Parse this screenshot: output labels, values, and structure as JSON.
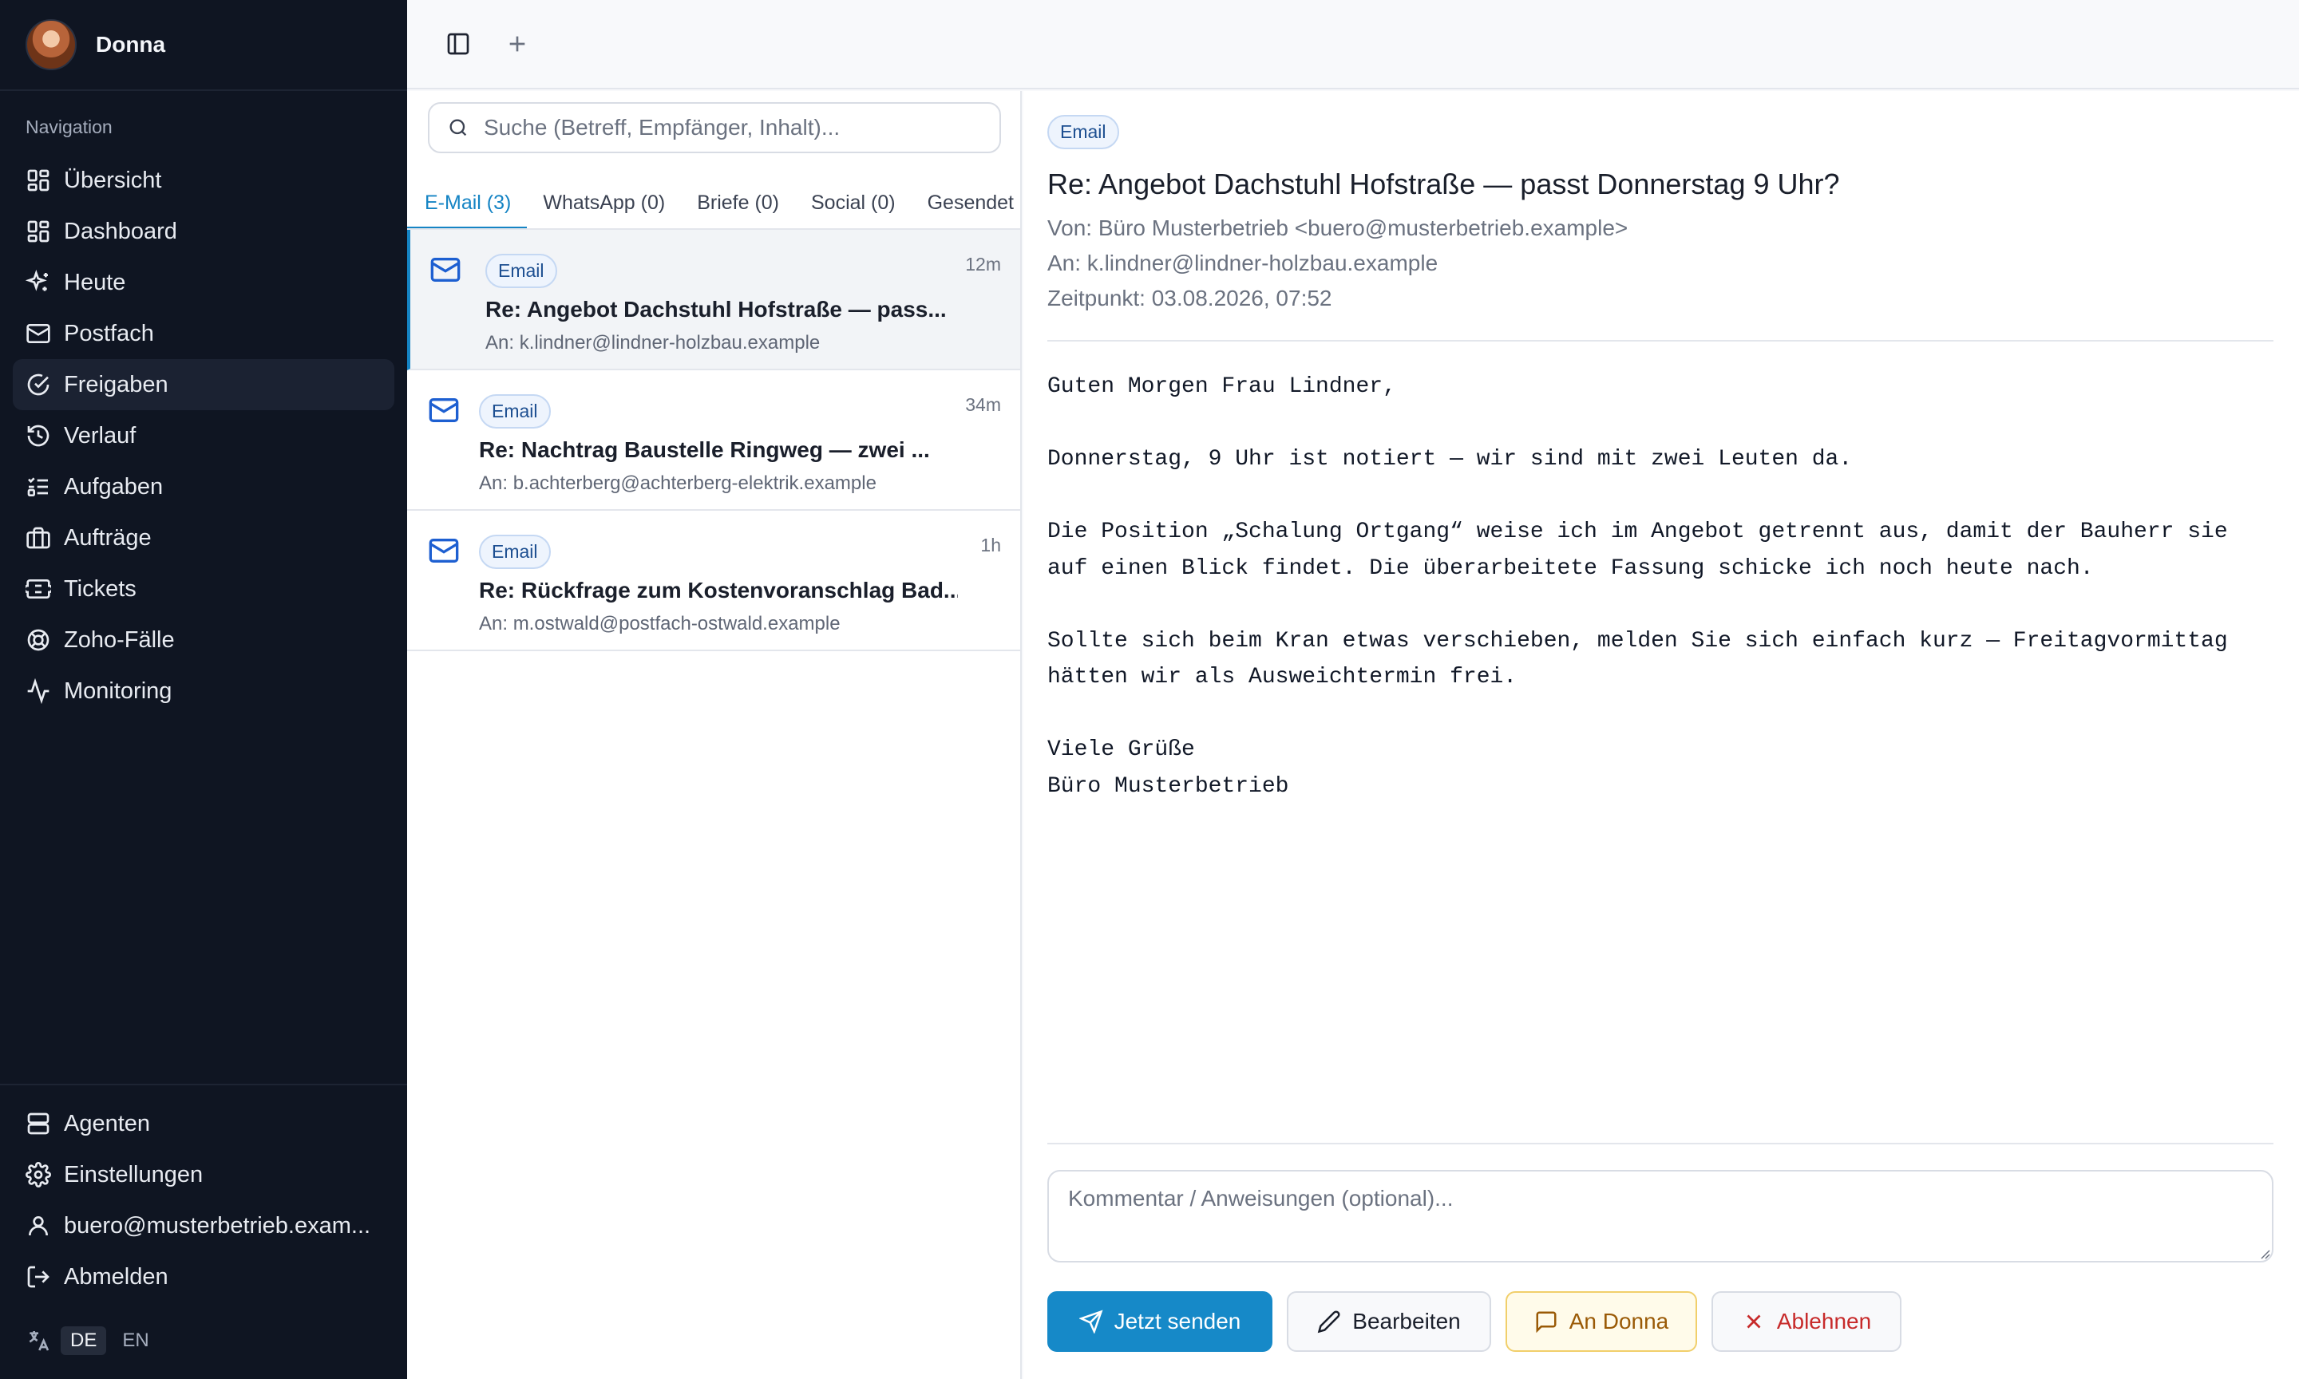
{
  "user": {
    "name": "Donna"
  },
  "sidebar": {
    "nav_label": "Navigation",
    "items": [
      {
        "label": "Übersicht",
        "icon": "layout-grid-icon"
      },
      {
        "label": "Dashboard",
        "icon": "dashboard-icon"
      },
      {
        "label": "Heute",
        "icon": "sparkles-icon"
      },
      {
        "label": "Postfach",
        "icon": "mail-icon"
      },
      {
        "label": "Freigaben",
        "icon": "check-circle-icon",
        "active": true
      },
      {
        "label": "Verlauf",
        "icon": "history-icon"
      },
      {
        "label": "Aufgaben",
        "icon": "list-todo-icon"
      },
      {
        "label": "Aufträge",
        "icon": "briefcase-icon"
      },
      {
        "label": "Tickets",
        "icon": "ticket-icon"
      },
      {
        "label": "Zoho-Fälle",
        "icon": "lifebuoy-icon"
      },
      {
        "label": "Monitoring",
        "icon": "activity-icon"
      }
    ],
    "bottom": [
      {
        "label": "Agenten",
        "icon": "server-icon"
      },
      {
        "label": "Einstellungen",
        "icon": "gear-icon"
      },
      {
        "label": "buero@musterbetrieb.exam...",
        "icon": "user-icon"
      },
      {
        "label": "Abmelden",
        "icon": "logout-icon"
      }
    ],
    "lang": {
      "active": "DE",
      "other": "EN"
    }
  },
  "list": {
    "search_placeholder": "Suche (Betreff, Empfänger, Inhalt)...",
    "tabs": [
      "E-Mail (3)",
      "WhatsApp (0)",
      "Briefe (0)",
      "Social (0)",
      "Gesendet"
    ],
    "messages": [
      {
        "badge": "Email",
        "time": "12m",
        "subject": "Re: Angebot Dachstuhl Hofstraße — pass...",
        "to": "An: k.lindner@lindner-holzbau.example"
      },
      {
        "badge": "Email",
        "time": "34m",
        "subject": "Re: Nachtrag Baustelle Ringweg — zwei ...",
        "to": "An: b.achterberg@achterberg-elektrik.example"
      },
      {
        "badge": "Email",
        "time": "1h",
        "subject": "Re: Rückfrage zum Kostenvoranschlag Bad...",
        "to": "An: m.ostwald@postfach-ostwald.example"
      }
    ]
  },
  "detail": {
    "badge": "Email",
    "subject": "Re: Angebot Dachstuhl Hofstraße — passt Donnerstag 9 Uhr?",
    "from": "Von: Büro Musterbetrieb <buero@musterbetrieb.example>",
    "to": "An: k.lindner@lindner-holzbau.example",
    "time": "Zeitpunkt: 03.08.2026, 07:52",
    "body": "Guten Morgen Frau Lindner,\n\nDonnerstag, 9 Uhr ist notiert — wir sind mit zwei Leuten da.\n\nDie Position „Schalung Ortgang“ weise ich im Angebot getrennt aus, damit der Bauherr sie auf einen Blick findet. Die überarbeitete Fassung schicke ich noch heute nach.\n\nSollte sich beim Kran etwas verschieben, melden Sie sich einfach kurz — Freitagvormittag hätten wir als Ausweichtermin frei.\n\nViele Grüße\nBüro Musterbetrieb",
    "comment_placeholder": "Kommentar / Anweisungen (optional)...",
    "actions": {
      "send": "Jetzt senden",
      "edit": "Bearbeiten",
      "donna": "An Donna",
      "reject": "Ablehnen"
    }
  },
  "colors": {
    "accent": "#1689c8",
    "sidebar_bg": "#0f1522",
    "donna_border": "#f1cf6b",
    "reject": "#c72a2a"
  }
}
